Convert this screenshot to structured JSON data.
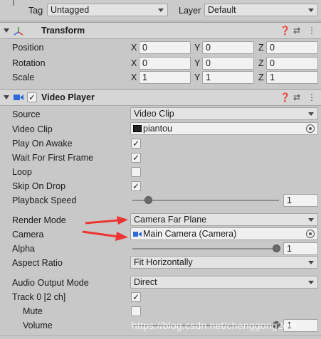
{
  "top": {
    "tag_label": "Tag",
    "tag_value": "Untagged",
    "layer_label": "Layer",
    "layer_value": "Default"
  },
  "transform": {
    "title": "Transform",
    "rows": [
      {
        "label": "Position",
        "x": "0",
        "y": "0",
        "z": "0"
      },
      {
        "label": "Rotation",
        "x": "0",
        "y": "0",
        "z": "0"
      },
      {
        "label": "Scale",
        "x": "1",
        "y": "1",
        "z": "1"
      }
    ],
    "axis_x": "X",
    "axis_y": "Y",
    "axis_z": "Z"
  },
  "video_player": {
    "title": "Video Player",
    "enabled_mark": "✓",
    "source_label": "Source",
    "source_value": "Video Clip",
    "video_clip_label": "Video Clip",
    "video_clip_value": "piantou",
    "play_on_awake_label": "Play On Awake",
    "play_on_awake_checked": true,
    "wait_first_frame_label": "Wait For First Frame",
    "wait_first_frame_checked": true,
    "loop_label": "Loop",
    "loop_checked": false,
    "skip_on_drop_label": "Skip On Drop",
    "skip_on_drop_checked": true,
    "playback_speed_label": "Playback Speed",
    "playback_speed_value": "1",
    "render_mode_label": "Render Mode",
    "render_mode_value": "Camera Far Plane",
    "camera_label": "Camera",
    "camera_value": "Main Camera (Camera)",
    "alpha_label": "Alpha",
    "alpha_value": "1",
    "aspect_ratio_label": "Aspect Ratio",
    "aspect_ratio_value": "Fit Horizontally",
    "audio_output_label": "Audio Output Mode",
    "audio_output_value": "Direct",
    "track_label": "Track 0 [2 ch]",
    "track_checked": true,
    "mute_label": "Mute",
    "mute_checked": false,
    "volume_label": "Volume",
    "volume_value": "1"
  },
  "check_glyph": "✓",
  "watermark": "https://blog.csdn.net/chenggong2dm",
  "colors": {
    "annotation_arrow": "#ee3333"
  }
}
